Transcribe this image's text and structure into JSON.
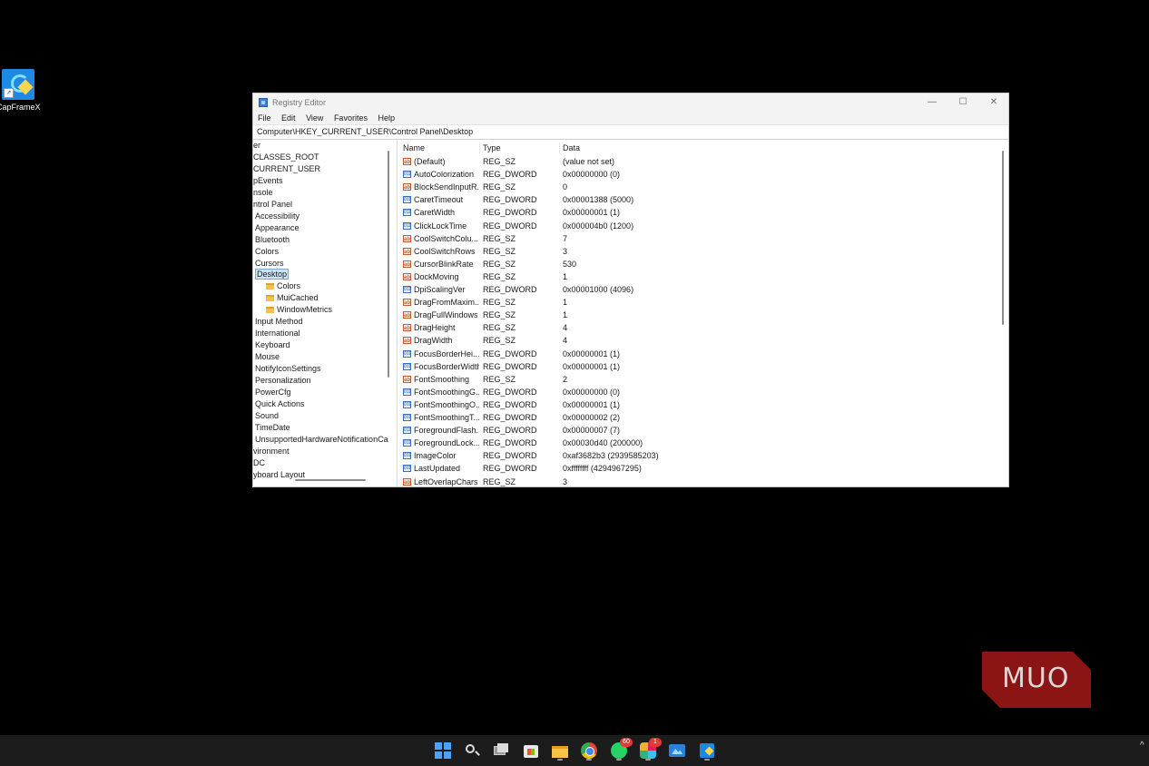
{
  "desktop": {
    "icons": [
      {
        "label": "CapFrameX",
        "icon": "capframex-icon"
      }
    ]
  },
  "window": {
    "title": "Registry Editor",
    "controls": {
      "minimize": "—",
      "maximize": "☐",
      "close": "✕"
    },
    "menu": [
      "File",
      "Edit",
      "View",
      "Favorites",
      "Help"
    ],
    "address": "Computer\\HKEY_CURRENT_USER\\Control Panel\\Desktop",
    "tree": [
      "er",
      "CLASSES_ROOT",
      "CURRENT_USER",
      "pEvents",
      "nsole",
      "ntrol Panel",
      "Accessibility",
      "Appearance",
      "Bluetooth",
      "Colors",
      "Cursors",
      "Desktop",
      "Colors",
      "MuiCached",
      "WindowMetrics",
      "Input Method",
      "International",
      "Keyboard",
      "Mouse",
      "NotifyIconSettings",
      "Personalization",
      "PowerCfg",
      "Quick Actions",
      "Sound",
      "TimeDate",
      "UnsupportedHardwareNotificationCa",
      "vironment",
      "DC",
      "yboard Layout"
    ],
    "columns": {
      "name": "Name",
      "type": "Type",
      "data": "Data"
    },
    "values": [
      {
        "name": "(Default)",
        "type": "REG_SZ",
        "data": "(value not set)",
        "icon": "string-value-icon"
      },
      {
        "name": "AutoColorization",
        "type": "REG_DWORD",
        "data": "0x00000000 (0)",
        "icon": "binary-value-icon"
      },
      {
        "name": "BlockSendInputR...",
        "type": "REG_SZ",
        "data": "0",
        "icon": "string-value-icon"
      },
      {
        "name": "CaretTimeout",
        "type": "REG_DWORD",
        "data": "0x00001388 (5000)",
        "icon": "binary-value-icon"
      },
      {
        "name": "CaretWidth",
        "type": "REG_DWORD",
        "data": "0x00000001 (1)",
        "icon": "binary-value-icon"
      },
      {
        "name": "ClickLockTime",
        "type": "REG_DWORD",
        "data": "0x000004b0 (1200)",
        "icon": "binary-value-icon"
      },
      {
        "name": "CoolSwitchColu...",
        "type": "REG_SZ",
        "data": "7",
        "icon": "string-value-icon"
      },
      {
        "name": "CoolSwitchRows",
        "type": "REG_SZ",
        "data": "3",
        "icon": "string-value-icon"
      },
      {
        "name": "CursorBlinkRate",
        "type": "REG_SZ",
        "data": "530",
        "icon": "string-value-icon"
      },
      {
        "name": "DockMoving",
        "type": "REG_SZ",
        "data": "1",
        "icon": "string-value-icon"
      },
      {
        "name": "DpiScalingVer",
        "type": "REG_DWORD",
        "data": "0x00001000 (4096)",
        "icon": "binary-value-icon"
      },
      {
        "name": "DragFromMaxim...",
        "type": "REG_SZ",
        "data": "1",
        "icon": "string-value-icon"
      },
      {
        "name": "DragFullWindows",
        "type": "REG_SZ",
        "data": "1",
        "icon": "string-value-icon"
      },
      {
        "name": "DragHeight",
        "type": "REG_SZ",
        "data": "4",
        "icon": "string-value-icon"
      },
      {
        "name": "DragWidth",
        "type": "REG_SZ",
        "data": "4",
        "icon": "string-value-icon"
      },
      {
        "name": "FocusBorderHei...",
        "type": "REG_DWORD",
        "data": "0x00000001 (1)",
        "icon": "binary-value-icon"
      },
      {
        "name": "FocusBorderWidth",
        "type": "REG_DWORD",
        "data": "0x00000001 (1)",
        "icon": "binary-value-icon"
      },
      {
        "name": "FontSmoothing",
        "type": "REG_SZ",
        "data": "2",
        "icon": "string-value-icon"
      },
      {
        "name": "FontSmoothingG...",
        "type": "REG_DWORD",
        "data": "0x00000000 (0)",
        "icon": "binary-value-icon"
      },
      {
        "name": "FontSmoothingO...",
        "type": "REG_DWORD",
        "data": "0x00000001 (1)",
        "icon": "binary-value-icon"
      },
      {
        "name": "FontSmoothingT...",
        "type": "REG_DWORD",
        "data": "0x00000002 (2)",
        "icon": "binary-value-icon"
      },
      {
        "name": "ForegroundFlash...",
        "type": "REG_DWORD",
        "data": "0x00000007 (7)",
        "icon": "binary-value-icon"
      },
      {
        "name": "ForegroundLock...",
        "type": "REG_DWORD",
        "data": "0x00030d40 (200000)",
        "icon": "binary-value-icon"
      },
      {
        "name": "ImageColor",
        "type": "REG_DWORD",
        "data": "0xaf3682b3 (2939585203)",
        "icon": "binary-value-icon"
      },
      {
        "name": "LastUpdated",
        "type": "REG_DWORD",
        "data": "0xffffffff (4294967295)",
        "icon": "binary-value-icon"
      },
      {
        "name": "LeftOverlapChars",
        "type": "REG_SZ",
        "data": "3",
        "icon": "string-value-icon"
      }
    ]
  },
  "watermark": {
    "text": "MUO",
    "color": "#8b1414"
  },
  "taskbar": {
    "apps": [
      {
        "name": "start",
        "icon": "windows-start-icon"
      },
      {
        "name": "search",
        "icon": "search-icon"
      },
      {
        "name": "task-view",
        "icon": "task-view-icon"
      },
      {
        "name": "store",
        "icon": "microsoft-store-icon"
      },
      {
        "name": "file-explorer",
        "icon": "folder-icon"
      },
      {
        "name": "chrome",
        "icon": "chrome-icon"
      },
      {
        "name": "whatsapp",
        "icon": "whatsapp-icon",
        "badge": "60"
      },
      {
        "name": "slack",
        "icon": "slack-icon",
        "badge": "1"
      },
      {
        "name": "photos",
        "icon": "photos-icon"
      },
      {
        "name": "capframex",
        "icon": "capframex-icon"
      }
    ],
    "tray_chevron": "^"
  }
}
